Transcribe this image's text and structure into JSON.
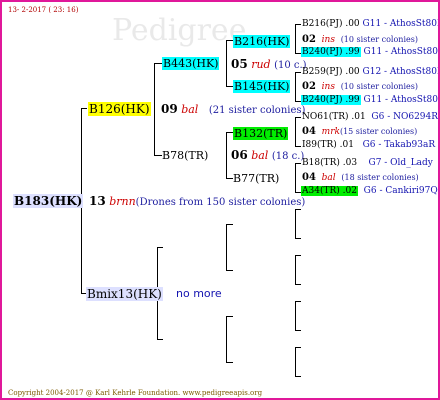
{
  "header": {
    "date": "13- 2-2017 ( 23: 16)"
  },
  "footer": {
    "copyright": "Copyright 2004-2017 @ Karl Kehrle Foundation.   www.pedigreeapis.org"
  },
  "root": {
    "label": "B183(HK)"
  },
  "mid": {
    "num": "13",
    "race": "brnn",
    "desc": "(Drones from 150 sister colonies)"
  },
  "sire": {
    "label": "Bmix13(HK)",
    "note": "no more"
  },
  "dam": {
    "label": "B126(HK)",
    "num": "09",
    "race": "bal",
    "desc": "(21 sister colonies)"
  },
  "b443": {
    "label": "B443(HK)",
    "num": "05",
    "race": "rud",
    "desc": "(10 c.)"
  },
  "b78": {
    "label": "B78(TR)",
    "num": "06",
    "race": "bal",
    "desc": "(18 c.)"
  },
  "b216": {
    "label": "B216(HK)"
  },
  "b145": {
    "label": "B145(HK)"
  },
  "b132": {
    "label": "B132(TR)"
  },
  "b77": {
    "label": "B77(TR)"
  },
  "r1": {
    "a": "B216(PJ) .00",
    "a_g": "G11 - AthosSt80R",
    "num": "02",
    "race": "ins",
    "desc": "(10 sister colonies)",
    "b": "B240(PJ) .99",
    "b_g": "G11 - AthosSt80R"
  },
  "r2": {
    "a": "B259(PJ) .00",
    "a_g": "G12 - AthosSt80R",
    "num": "02",
    "race": "ins",
    "desc": "(10 sister colonies)",
    "b": "B240(PJ) .99",
    "b_g": "G11 - AthosSt80R"
  },
  "r3": {
    "a": "NO61(TR) .01",
    "a_g": "G6 - NO6294R",
    "num": "04",
    "race": "mrk",
    "desc": "(15 sister colonies)",
    "b": "I89(TR) .01",
    "b_g": "G6 - Takab93aR"
  },
  "r4": {
    "a": "B18(TR) .03",
    "a_g": "G7 - Old_Lady",
    "num": "04",
    "race": "bal",
    "desc": "(18 sister colonies)",
    "b": "A34(TR) .02",
    "b_g": "G6 - Cankiri97Q"
  },
  "colors": {
    "border": "#e0189a",
    "yellow": "#ffff00",
    "cyan": "#00ffff",
    "green": "#00ee00"
  }
}
